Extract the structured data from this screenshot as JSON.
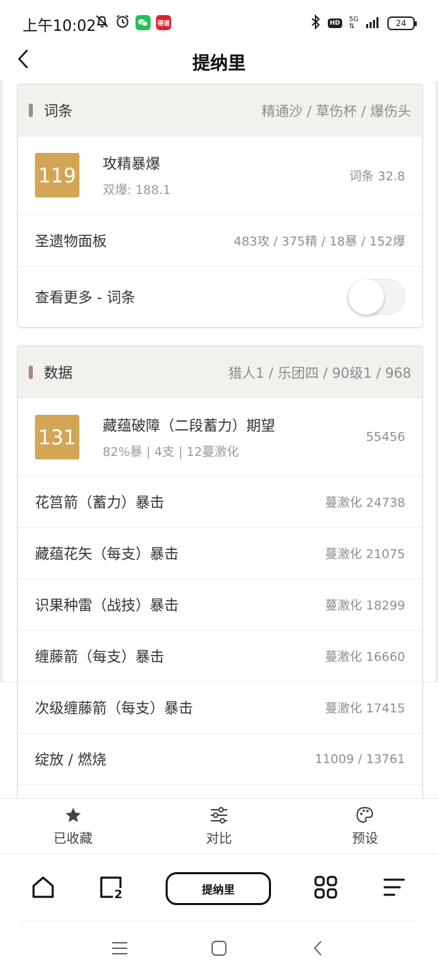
{
  "status_bar": {
    "time": "上午10:02",
    "badge_app": "得道",
    "hd": "HD",
    "network": "5G",
    "battery": "24"
  },
  "header": {
    "title": "提纳里"
  },
  "stats_card": {
    "title": "词条",
    "subtitle": "精通沙 / 草伤杯 / 爆伤头",
    "main": {
      "badge": "119",
      "title": "攻精暴爆",
      "sub": "双爆: 188.1",
      "value": "词条 32.8"
    },
    "rows": [
      {
        "label": "圣遗物面板",
        "value": "483攻 / 375精 / 18暴 / 152爆"
      }
    ],
    "toggle_label": "查看更多 - 词条",
    "toggle_on": false
  },
  "data_card": {
    "title": "数据",
    "subtitle": "猎人1 / 乐团四 / 90级1 / 968",
    "main": {
      "badge": "131",
      "title": "藏蕴破障（二段蓄力）期望",
      "sub": "82%暴 | 4支 | 12蔓激化",
      "value": "55456"
    },
    "rows": [
      {
        "label": "花筥箭（蓄力）暴击",
        "value": "蔓激化 24738"
      },
      {
        "label": "藏蕴花矢（每支）暴击",
        "value": "蔓激化 21075"
      },
      {
        "label": "识果种雷（战技）暴击",
        "value": "蔓激化 18299"
      },
      {
        "label": "缠藤箭（每支）暴击",
        "value": "蔓激化 16660"
      },
      {
        "label": "次级缠藤箭（每支）暴击",
        "value": "蔓激化 17415"
      },
      {
        "label": "绽放 / 燃烧",
        "value": "11009 / 13761"
      }
    ]
  },
  "action_bar": {
    "favorites": "已收藏",
    "compare": "对比",
    "preset": "预设"
  },
  "bottom_nav": {
    "center_label": "提纳里",
    "tab2_number": "2"
  },
  "colors": {
    "badge_gold": "#d2a655",
    "card_header_bg": "#f3f1ed",
    "accent_bar": "#a08c80"
  }
}
